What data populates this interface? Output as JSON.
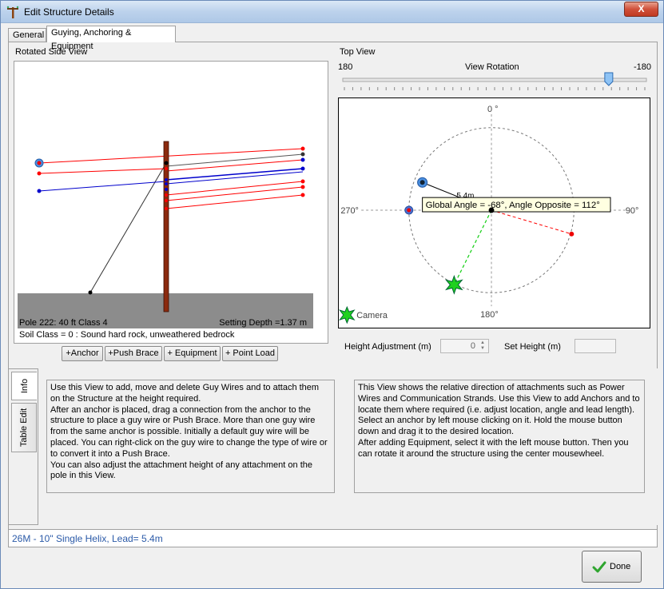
{
  "window": {
    "title": "Edit Structure Details",
    "close_label": "X"
  },
  "tabs": [
    {
      "label": "General",
      "active": false
    },
    {
      "label": "Guying, Anchoring & Equipment",
      "active": true
    }
  ],
  "side_view": {
    "group_label": "Rotated Side View",
    "pole_label": "Pole 222: 40 ft Class 4",
    "setting_depth": "Setting Depth =1.37 m",
    "soil_class": "Soil Class = 0 : Sound hard rock, unweathered bedrock",
    "buttons": [
      "+Anchor",
      "+Push Brace",
      "+ Equipment",
      "+ Point Load"
    ]
  },
  "top_view": {
    "group_label": "Top View",
    "rotation_left": "180",
    "rotation_title": "View Rotation",
    "rotation_right": "-180",
    "slider_fraction": 0.88,
    "compass": {
      "top": "0 °",
      "right": "90°",
      "bottom": "180°",
      "left": "270°"
    },
    "lead_label": "5.4m",
    "tooltip": "Global Angle = -68°, Angle Opposite = 112°",
    "camera_label": "Camera"
  },
  "controls": {
    "height_adjustment_label": "Height Adjustment (m)",
    "height_adjustment_value": "0",
    "set_height_label": "Set Height (m)",
    "set_height_value": ""
  },
  "info_tabs": [
    {
      "label": "Info",
      "active": true
    },
    {
      "label": "Table Edit",
      "active": false
    }
  ],
  "info": {
    "left_text": "Use this View to add, move and delete Guy Wires and to attach them on the Structure at the height required.\nAfter an anchor is placed, drag a connection from the anchor to the structure to place a guy wire or Push Brace. More than one guy wire from the same anchor is possible. Initially a default guy wire will be placed. You can right-click on the guy wire to change the type of wire or to convert it into a Push Brace.\nYou can also adjust the attachment height of any attachment on the pole in this View.",
    "right_text": "This View shows the relative direction of attachments such as Power Wires and Communication Strands. Use this View to add Anchors and to locate them where required (i.e. adjust location, angle and lead length). Select an anchor by left mouse clicking on it. Hold the mouse button down and drag it to the desired location.\nAfter adding Equipment, select it with the left mouse button. Then you can rotate it around the structure using the center mousewheel."
  },
  "status": {
    "text": "26M - 10\" Single Helix, Lead= 5.4m"
  },
  "done_label": "Done",
  "colors": {
    "power_wire": "#ff0000",
    "comm_strand": "#0000cc",
    "guy_wire": "#333333",
    "pole": "#8b2a0e",
    "ground": "#8c8c8c",
    "anchor_marker": "#1fd11f",
    "status_text": "#2b5aa8"
  }
}
